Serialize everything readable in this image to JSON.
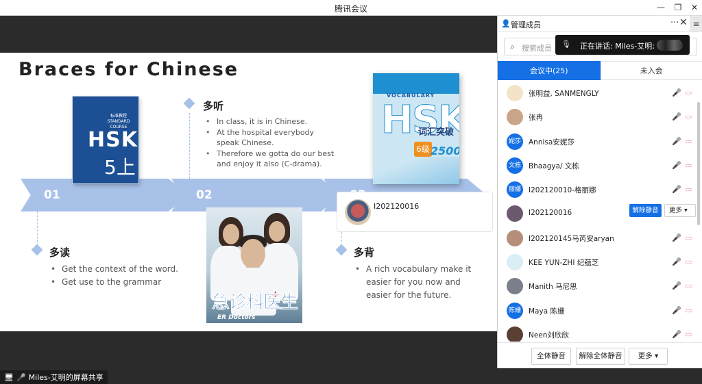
{
  "window": {
    "title": "腾讯会议",
    "btn_min": "—",
    "btn_restore": "❐",
    "btn_close": "✕"
  },
  "slide": {
    "title": "Braces for Chinese",
    "steps": [
      "01",
      "02",
      "03"
    ],
    "sec1": {
      "heading": "多听",
      "bullets": [
        "In class, it is in Chinese.",
        "At the hospital everybody speak Chinese.",
        "Therefore we gotta do our best and enjoy it also (C-drama)."
      ]
    },
    "sec2": {
      "heading": "多读",
      "bullets": [
        "Get the context of the word.",
        "Get use to the grammar"
      ]
    },
    "sec3": {
      "heading": "多背",
      "bullets": [
        "A rich vocabulary make it easier for you now and easier for the future."
      ]
    },
    "book1": {
      "series": "标准教程",
      "subtitle": "STANDARD COURSE",
      "brand": "HSK",
      "level": "5上"
    },
    "book2": {
      "top": "VOCABULARY",
      "brand": "HSK",
      "name": "词汇突破",
      "level": "6级",
      "count": "2500"
    },
    "poster": {
      "title": "急诊科医生",
      "subtitle": "ER Doctors",
      "cross": "+"
    },
    "speaker_tile": {
      "name": "I202120016"
    }
  },
  "share_bar": {
    "text": "Miles-艾明的屏幕共享"
  },
  "panel": {
    "title": "管理成员",
    "more": "···",
    "close": "✕",
    "menu": "≡",
    "search_placeholder": "搜索成员",
    "toast": "正在讲话: Miles-艾明;",
    "tabs": [
      "会议中(25)",
      "未入会"
    ],
    "members": [
      {
        "name": "张明益, SANMENGLY",
        "avatar": "",
        "color": "#f3e3c8"
      },
      {
        "name": "张冉",
        "avatar": "",
        "color": "#c9a58a"
      },
      {
        "name": "Annisa安妮莎",
        "avatar": "妮莎",
        "color": "#1570e6"
      },
      {
        "name": "Bhaagya/ 文栋",
        "avatar": "文栋",
        "color": "#1570e6"
      },
      {
        "name": "I202120010-格丽娜",
        "avatar": "丽娜",
        "color": "#1570e6"
      },
      {
        "name": "I202120016",
        "avatar": "",
        "color": "#6b5a6e"
      },
      {
        "name": "I202120145马芮安aryan",
        "avatar": "",
        "color": "#b58f7a"
      },
      {
        "name": "KEE YUN-ZHI 纪蕴芝",
        "avatar": "",
        "color": "#d9eef5"
      },
      {
        "name": "Manith 马尼思",
        "avatar": "",
        "color": "#7a7f8a"
      },
      {
        "name": "Maya 陈姗",
        "avatar": "陈姗",
        "color": "#1570e6"
      },
      {
        "name": "Neen刘欣欣",
        "avatar": "",
        "color": "#5a3f34"
      }
    ],
    "row_actions": {
      "unmute": "解除静音",
      "more": "更多 ▾"
    },
    "footer": {
      "mute_all": "全体静音",
      "unmute_all": "解除全体静音",
      "more": "更多 ▾"
    }
  }
}
